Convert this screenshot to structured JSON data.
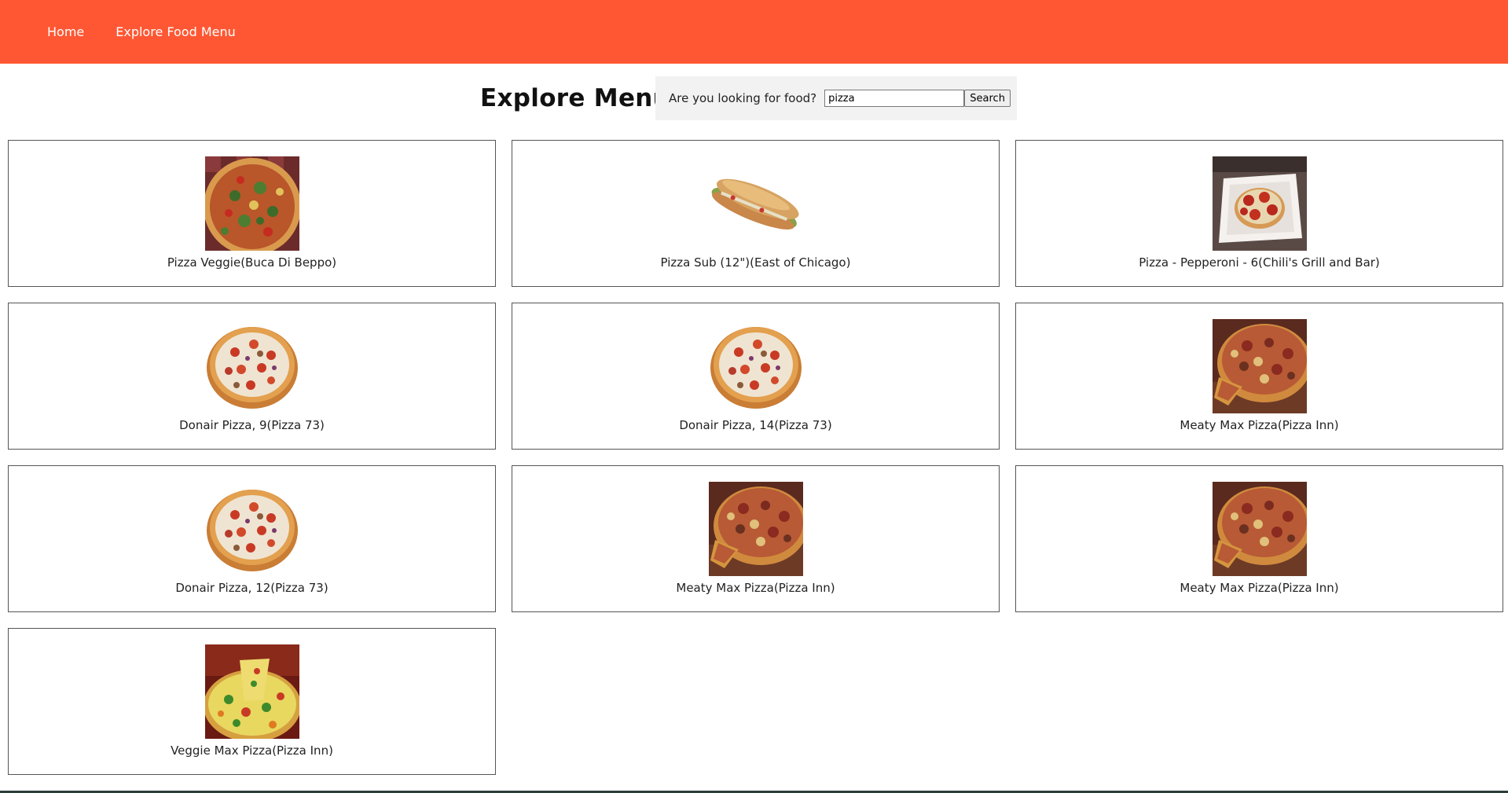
{
  "nav": {
    "home": "Home",
    "explore": "Explore Food Menu"
  },
  "page": {
    "title": "Explore Menu"
  },
  "search": {
    "label": "Are you looking for food?",
    "value": "pizza",
    "button": "Search"
  },
  "colors": {
    "navbar": "#ff5733",
    "search_bg": "#f2f2f2"
  },
  "items": [
    {
      "name": "Pizza Veggie(Buca Di Beppo)",
      "image": "veggie-pizza-image"
    },
    {
      "name": "Pizza Sub (12\")(East of Chicago)",
      "image": "sub-sandwich-image"
    },
    {
      "name": "Pizza - Pepperoni - 6(Chili's Grill and Bar)",
      "image": "pepperoni-pizza-plate-image"
    },
    {
      "name": "Donair Pizza, 9(Pizza 73)",
      "image": "donair-pizza-image"
    },
    {
      "name": "Donair Pizza, 14(Pizza 73)",
      "image": "donair-pizza-image"
    },
    {
      "name": "Meaty Max Pizza(Pizza Inn)",
      "image": "meaty-max-pizza-image"
    },
    {
      "name": "Donair Pizza, 12(Pizza 73)",
      "image": "donair-pizza-image"
    },
    {
      "name": "Meaty Max Pizza(Pizza Inn)",
      "image": "meaty-max-pizza-image"
    },
    {
      "name": "Meaty Max Pizza(Pizza Inn)",
      "image": "meaty-max-pizza-image"
    },
    {
      "name": "Veggie Max Pizza(Pizza Inn)",
      "image": "veggie-max-pizza-image"
    }
  ]
}
